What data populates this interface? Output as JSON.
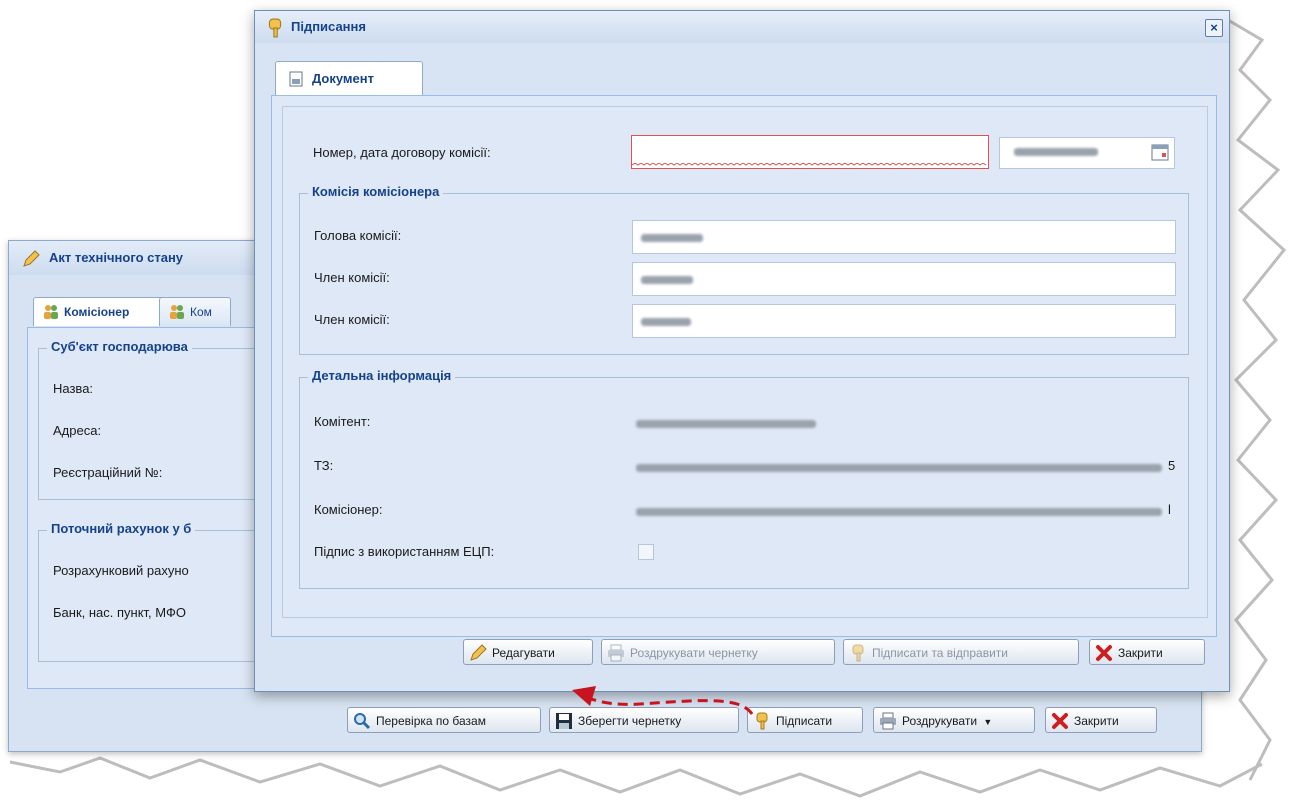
{
  "background_window": {
    "title": "Акт технічного стану",
    "tabs": [
      {
        "label": "Комісіонер"
      },
      {
        "label": "Ком"
      }
    ],
    "section_subject": {
      "legend": "Суб'єкт господарюва",
      "fields": [
        "Назва:",
        "Адреса:",
        "Реєстраційний №:"
      ]
    },
    "section_account": {
      "legend": "Поточний рахунок у б",
      "fields": [
        "Розрахунковий рахуно",
        "Банк, нас. пункт, МФО"
      ]
    },
    "buttons": {
      "check": "Перевірка по базам",
      "save_draft": "Зберегти чернетку",
      "sign": "Підписати",
      "print": "Роздрукувати",
      "close": "Закрити"
    }
  },
  "dialog": {
    "title": "Підписання",
    "close_glyph": "×",
    "tab": "Документ",
    "contract_label": "Номер, дата договору комісії:",
    "commission": {
      "legend": "Комісія комісіонера",
      "head_label": "Голова комісії:",
      "member_label_1": "Член комісії:",
      "member_label_2": "Член комісії:"
    },
    "details": {
      "legend": "Детальна інформація",
      "committent_label": "Комітент:",
      "tz_label": "ТЗ:",
      "tz_trailing": "5",
      "commissioner_label": "Комісіонер:",
      "commissioner_trailing": "l",
      "ecp_label": "Підпис з використанням ЕЦП:"
    },
    "buttons": {
      "edit": "Редагувати",
      "print_draft": "Роздрукувати чернетку",
      "sign_send": "Підписати та відправити",
      "close": "Закрити"
    }
  },
  "icons": {
    "pencil": "pencil-icon",
    "users": "users-icon",
    "key": "key-icon",
    "printer": "printer-icon",
    "close": "red-x-icon",
    "disk": "floppy-disk-icon",
    "search": "magnifier-icon",
    "calendar": "calendar-icon",
    "document": "document-icon"
  },
  "colors": {
    "accent": "#15428b",
    "error_border": "#d9534f",
    "close_red": "#cc1f1f",
    "annotation_arrow": "#c8141e"
  }
}
